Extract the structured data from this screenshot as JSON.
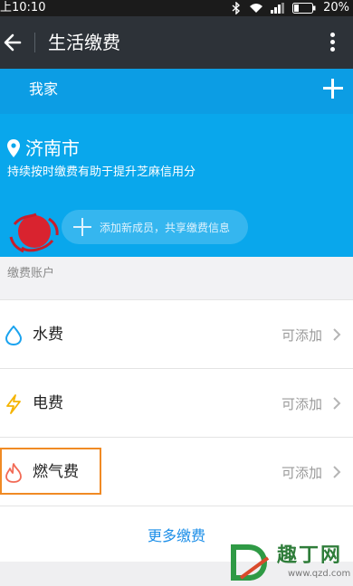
{
  "status_bar": {
    "time": "上10:10",
    "battery": "20%"
  },
  "header": {
    "title": "生活缴费"
  },
  "household": {
    "name": "我家",
    "city": "济南市",
    "hint": "持续按时缴费有助于提升芝麻信用分",
    "add_member": "添加新成员，共享缴费信息"
  },
  "section": {
    "title": "缴费账户"
  },
  "accounts": [
    {
      "name": "水费",
      "status": "可添加",
      "icon": "water-drop-icon",
      "color": "#1aa3ef"
    },
    {
      "name": "电费",
      "status": "可添加",
      "icon": "lightning-icon",
      "color": "#f5b400"
    },
    {
      "name": "燃气费",
      "status": "可添加",
      "icon": "flame-icon",
      "color": "#f26a55"
    }
  ],
  "more": {
    "label": "更多缴费"
  },
  "watermark": {
    "text": "趣丁网",
    "url": "www.qzd.com"
  },
  "colors": {
    "accent": "#09a7ec",
    "titlebar": "#2d3238",
    "link": "#1b8ee8",
    "highlight": "#f08a24"
  }
}
